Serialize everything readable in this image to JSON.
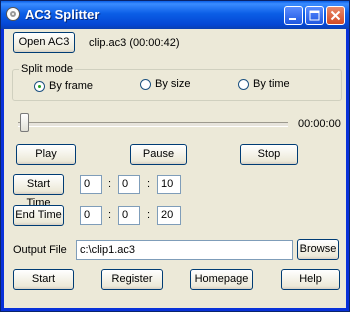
{
  "window": {
    "title": "AC3 Splitter"
  },
  "file": {
    "open_label": "Open AC3",
    "info": "clip.ac3  (00:00:42)"
  },
  "split_mode": {
    "label": "Split mode",
    "options": [
      {
        "label": "By frame",
        "selected": true
      },
      {
        "label": "By size",
        "selected": false
      },
      {
        "label": "By time",
        "selected": false
      }
    ]
  },
  "position": {
    "value": 0,
    "time": "00:00:00"
  },
  "playback": {
    "play": "Play",
    "pause": "Pause",
    "stop": "Stop"
  },
  "start_time": {
    "label": "Start Time",
    "h": "0",
    "m": "0",
    "s": "10"
  },
  "end_time": {
    "label": "End Time",
    "h": "0",
    "m": "0",
    "s": "20"
  },
  "time_separator": ":",
  "output": {
    "label": "Output File",
    "value": "c:\\clip1.ac3",
    "browse": "Browse"
  },
  "actions": {
    "start": "Start",
    "register": "Register",
    "homepage": "Homepage",
    "help": "Help"
  }
}
